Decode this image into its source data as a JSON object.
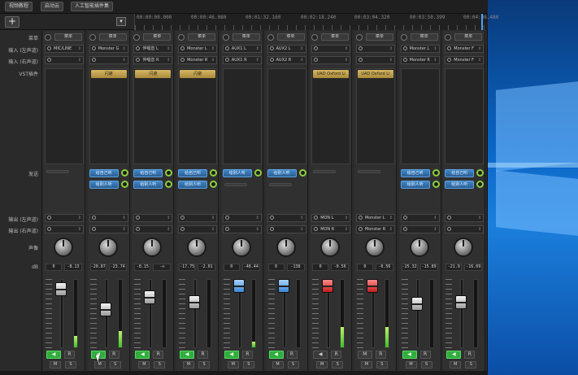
{
  "topbar": {
    "buttons": [
      "视频教程",
      "启动云",
      "人工智能插件集"
    ]
  },
  "toolbar": {
    "add_label": "+",
    "dropdown_label": "▾"
  },
  "ruler": {
    "ticks": [
      "00:00:00.000",
      "00:00:46.080",
      "00:01:32.160",
      "00:02:18.240",
      "00:03:04.320",
      "00:03:50.399",
      "00:04:36.480"
    ]
  },
  "labels": {
    "menu": "菜单",
    "input_left": "输入 (左声道)",
    "input_right": "输入 (右声道)",
    "vst": "VST插件",
    "sends": "发送",
    "output_left": "输出 (左声道)",
    "output_right": "输出 (右声道)",
    "pan": "声像",
    "db": "dB"
  },
  "strips": [
    {
      "menu": "菜单",
      "in_l": "MIC/LINE",
      "in_r": "",
      "plugin": "",
      "sends": [],
      "out_l": "",
      "out_r": "",
      "db_l": "0",
      "db_r": "-8.13",
      "fader": "grey",
      "fader_pos": 0.06,
      "meter": 0.17,
      "mon_on": true,
      "mon_label": "◀"
    },
    {
      "menu": "菜单",
      "in_l": "Monster G",
      "in_r": "",
      "plugin": "闪避",
      "sends": [
        "给自己听",
        "给别人听"
      ],
      "out_l": "",
      "out_r": "",
      "db_l": "-20.87",
      "db_r": "-23.74",
      "fader": "grey",
      "fader_pos": 0.42,
      "meter": 0.24,
      "mon_on": true,
      "mon_label": "◀"
    },
    {
      "menu": "菜单",
      "in_l": "伴唱音 L",
      "in_r": "伴唱音 R",
      "plugin": "闪避",
      "sends": [
        "给自己听",
        "给别人听"
      ],
      "out_l": "",
      "out_r": "",
      "db_l": "-8.15",
      "db_r": "-∞",
      "fader": "grey",
      "fader_pos": 0.2,
      "meter": 0.0,
      "mon_on": true,
      "mon_label": "◀"
    },
    {
      "menu": "菜单",
      "in_l": "Monster L",
      "in_r": "Monster R",
      "plugin": "闪避",
      "sends": [
        "给自己听",
        "给别人听"
      ],
      "out_l": "",
      "out_r": "",
      "db_l": "-17.75",
      "db_r": "-2.01",
      "fader": "grey",
      "fader_pos": 0.3,
      "meter": 0.0,
      "mon_on": true,
      "mon_label": "◀"
    },
    {
      "menu": "菜单",
      "in_l": "AUX1 L",
      "in_r": "AUX1 R",
      "plugin": "",
      "sends": [
        "给别人听"
      ],
      "out_l": "",
      "out_r": "",
      "db_l": "0",
      "db_r": "-48.44",
      "fader": "blue",
      "fader_pos": 0.0,
      "meter": 0.08,
      "mon_on": true,
      "mon_label": "◀"
    },
    {
      "menu": "菜单",
      "in_l": "AUX2 L",
      "in_r": "AUX2 R",
      "plugin": "",
      "sends": [
        "给别人听"
      ],
      "out_l": "",
      "out_r": "",
      "db_l": "0",
      "db_r": "-138",
      "fader": "blue",
      "fader_pos": 0.0,
      "meter": 0.0,
      "mon_on": true,
      "mon_label": "◀"
    },
    {
      "menu": "菜单",
      "in_l": "",
      "in_r": "",
      "plugin": "UAD Oxford Li",
      "sends": [],
      "out_l": "MON L",
      "out_r": "MON R",
      "db_l": "0",
      "db_r": "-0.56",
      "fader": "red",
      "fader_pos": 0.0,
      "meter": 0.3,
      "mon_on": false,
      "mon_label": "◀"
    },
    {
      "menu": "菜单",
      "in_l": "",
      "in_r": "",
      "plugin": "UAD Oxford Li",
      "sends": [],
      "out_l": "Monster L",
      "out_r": "Monster R",
      "db_l": "0",
      "db_r": "-0.56",
      "fader": "red",
      "fader_pos": 0.0,
      "meter": 0.3,
      "mon_on": false,
      "mon_label": "M"
    },
    {
      "menu": "菜单",
      "in_l": "Monster L",
      "in_r": "Monster R",
      "plugin": "",
      "sends": [
        "给自己听",
        "给别人听"
      ],
      "out_l": "",
      "out_r": "",
      "db_l": "-25.32",
      "db_r": "-15.89",
      "fader": "grey",
      "fader_pos": 0.33,
      "meter": 0.0,
      "mon_on": true,
      "mon_label": "◀"
    },
    {
      "menu": "菜单",
      "in_l": "Monster F",
      "in_r": "Monster F",
      "plugin": "",
      "sends": [
        "给自己听",
        "给别人听"
      ],
      "out_l": "",
      "out_r": "",
      "db_l": "-21.9",
      "db_r": "-16.09",
      "fader": "grey",
      "fader_pos": 0.3,
      "meter": 0.0,
      "mon_on": true,
      "mon_label": "◀"
    }
  ],
  "buttons": {
    "read": "R",
    "mute": "M",
    "solo": "S"
  },
  "colors": {
    "accent": "#2fae3d",
    "send": "#3f86c7",
    "plugin": "#c8a852",
    "fader_red": "#c21c1c",
    "fader_blue": "#3a86d4"
  }
}
